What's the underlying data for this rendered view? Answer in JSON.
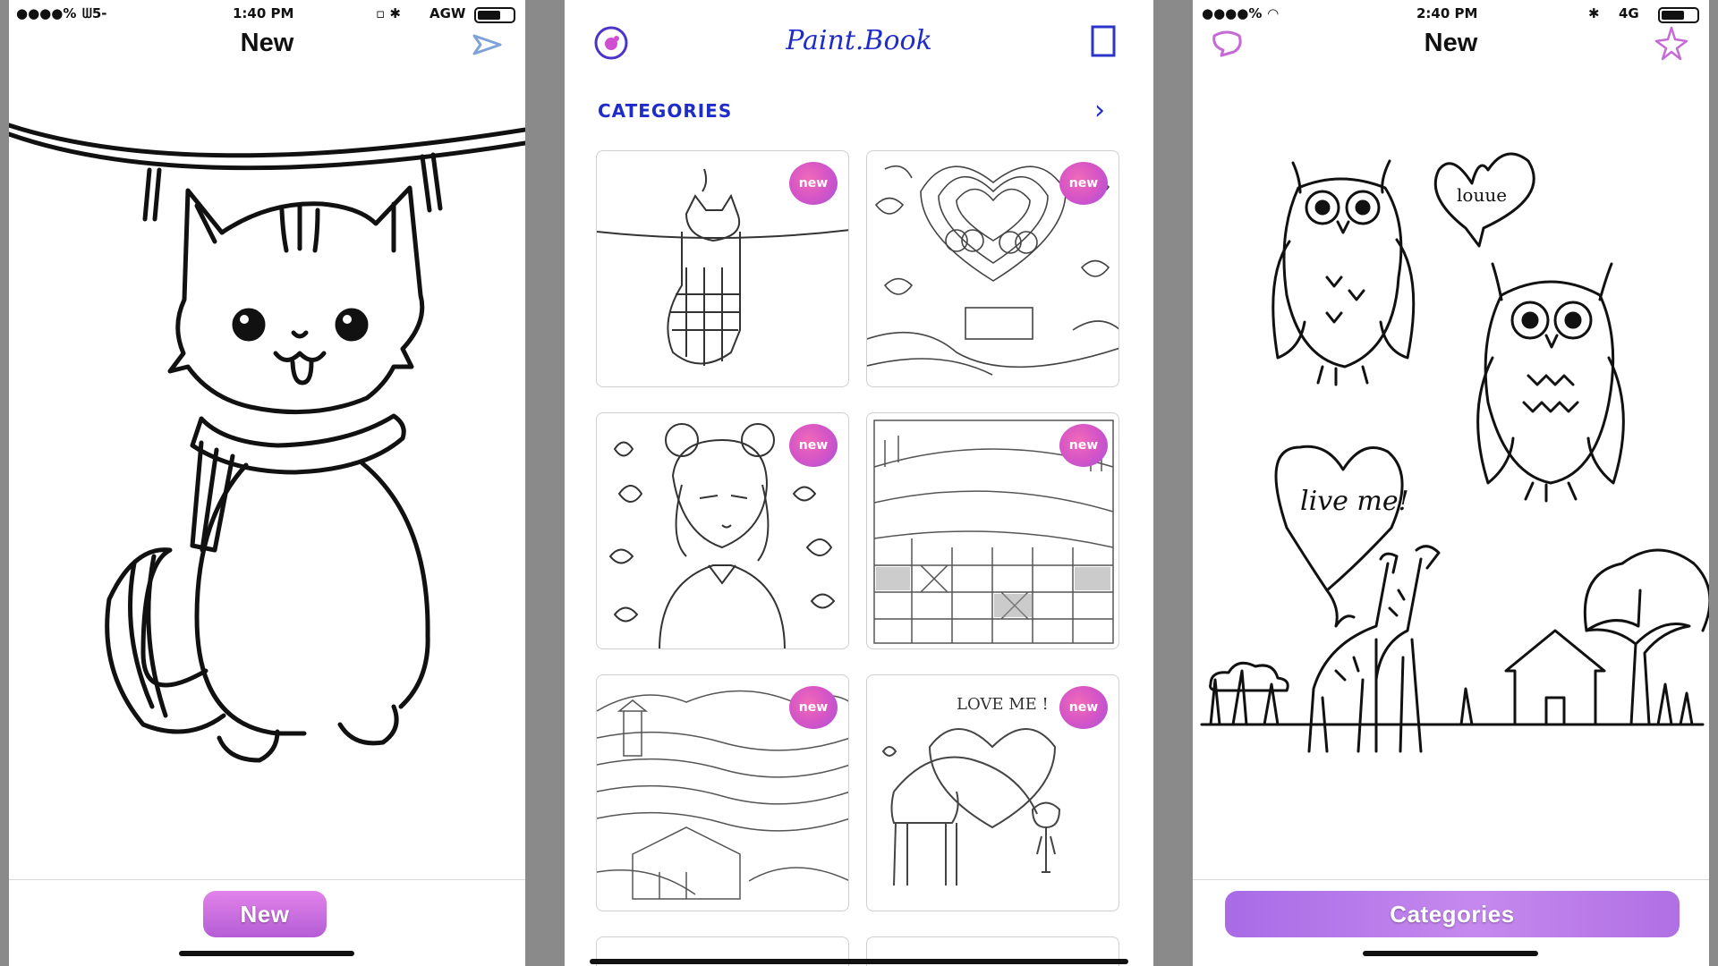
{
  "left_screen": {
    "status": {
      "signal": "●●●●%",
      "carrier": "ᗯ5-",
      "time": "1:40 PM",
      "icons": "▫ ✱",
      "network": "AGW"
    },
    "title": "New",
    "share_icon": "paper-plane-icon",
    "artwork": "cat-with-scarf-on-clothesline",
    "button_label": "New"
  },
  "center_screen": {
    "app_name": "Paint.Book",
    "section_title": "CATEGORIES",
    "section_arrow": "›",
    "cards": [
      {
        "badge": "new",
        "art": "cat-in-stocking"
      },
      {
        "badge": "new",
        "art": "owls-hearts-pattern"
      },
      {
        "badge": "new",
        "art": "girl-with-hearts"
      },
      {
        "badge": "new",
        "art": "patchwork-landscape"
      },
      {
        "badge": "new",
        "art": "lighthouse-landscape"
      },
      {
        "badge": "new",
        "art": "giraffe-love-me"
      }
    ],
    "card_captions": {
      "owls": "",
      "giraffe": "LOVE ME !"
    }
  },
  "right_screen": {
    "status": {
      "signal": "●●●●%",
      "time": "2:40 PM",
      "icons": "✱",
      "network": "4G"
    },
    "title": "New",
    "art_captions": {
      "heart_top": "louue",
      "heart_bottom": "live me!"
    },
    "button_label": "Categories"
  },
  "colors": {
    "accent_blue": "#1f2cc7",
    "button_pink": "#d06fe0",
    "button_purple": "#b77ae8",
    "badge_pink": "#e65fc0"
  }
}
